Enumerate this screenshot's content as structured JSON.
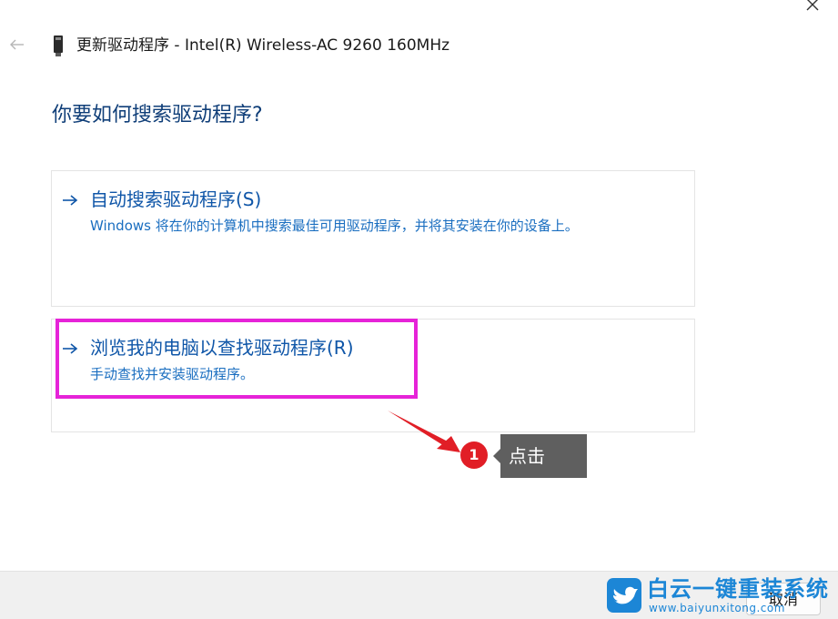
{
  "window": {
    "title": "更新驱动程序 - Intel(R) Wireless-AC 9260 160MHz",
    "device_icon": "wireless-adapter-icon",
    "back_icon": "back-arrow-icon",
    "close_icon": "close-icon"
  },
  "main": {
    "question": "你要如何搜索驱动程序?",
    "options": [
      {
        "arrow_icon": "right-arrow-icon",
        "title": "自动搜索驱动程序(S)",
        "description": "Windows 将在你的计算机中搜索最佳可用驱动程序，并将其安装在你的设备上。"
      },
      {
        "arrow_icon": "right-arrow-icon",
        "title": "浏览我的电脑以查找驱动程序(R)",
        "description": "手动查找并安装驱动程序。"
      }
    ]
  },
  "annotation": {
    "highlight_color": "#e623d8",
    "step_number": "1",
    "step_color": "#e11e26",
    "tooltip": "点击"
  },
  "footer": {
    "cancel_label": "取消"
  },
  "watermark": {
    "text_cn": "白云一键重装系统",
    "text_en": "www.baiyunxitong.com",
    "color": "#1c86d6"
  }
}
